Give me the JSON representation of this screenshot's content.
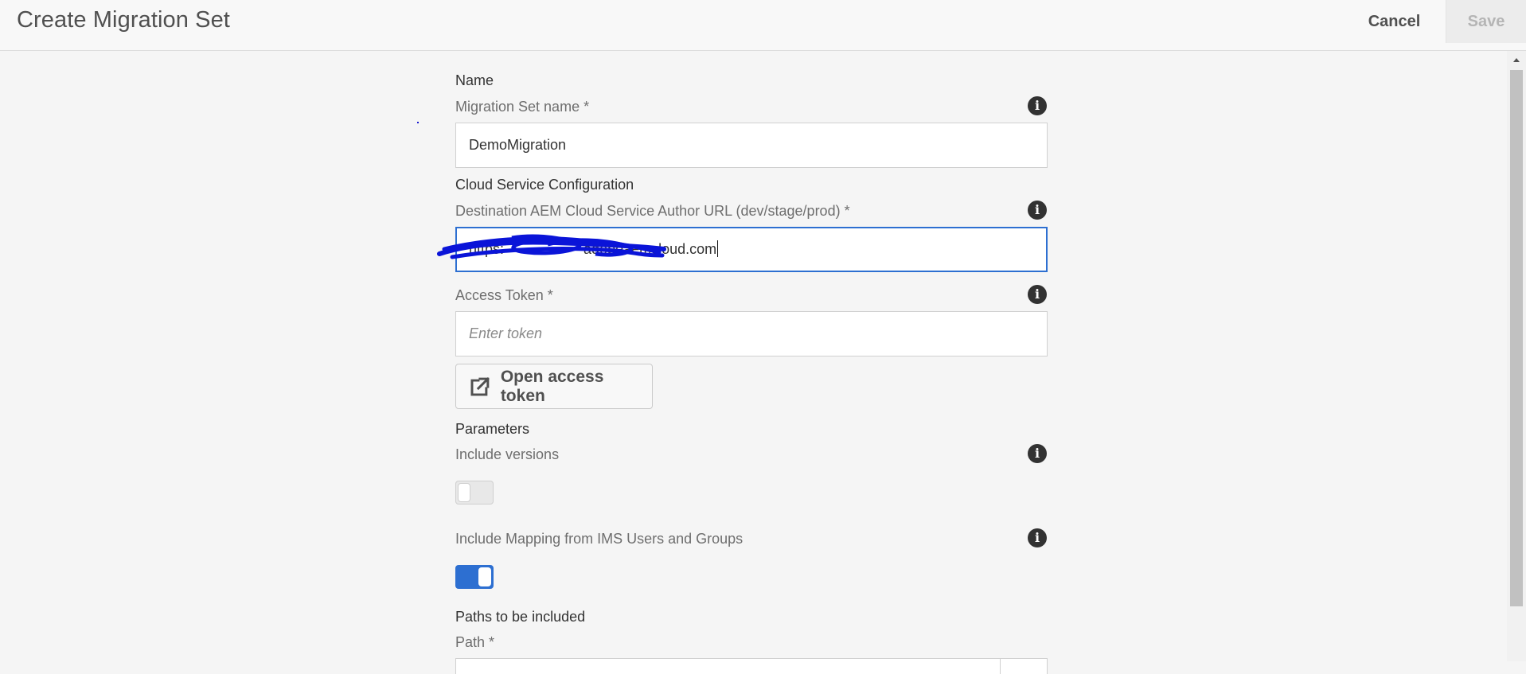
{
  "header": {
    "title": "Create Migration Set",
    "cancel_label": "Cancel",
    "save_label": "Save"
  },
  "form": {
    "name_section": "Name",
    "migration_set_name_label": "Migration Set name *",
    "migration_set_name_value": "DemoMigration",
    "cloud_section": "Cloud Service Configuration",
    "destination_url_label": "Destination AEM Cloud Service Author URL (dev/stage/prod) *",
    "destination_url_value": "https://adobeaemcloud.com",
    "destination_url_visible": "https:                    adobeaemcloud.com",
    "access_token_label": "Access Token *",
    "access_token_value": "",
    "access_token_placeholder": "Enter token",
    "open_token_button_label": "Open access token",
    "parameters_section": "Parameters",
    "include_versions_label": "Include versions",
    "include_versions_enabled": false,
    "include_mapping_label": "Include Mapping from IMS Users and Groups",
    "include_mapping_enabled": true,
    "paths_section": "Paths to be included",
    "path_label": "Path *"
  },
  "icons": {
    "info": "info-icon",
    "external_link": "external-link-icon",
    "scroll_up": "chevron-up-icon"
  },
  "colors": {
    "accent": "#2d6fd1",
    "redaction": "#0a14d8"
  }
}
